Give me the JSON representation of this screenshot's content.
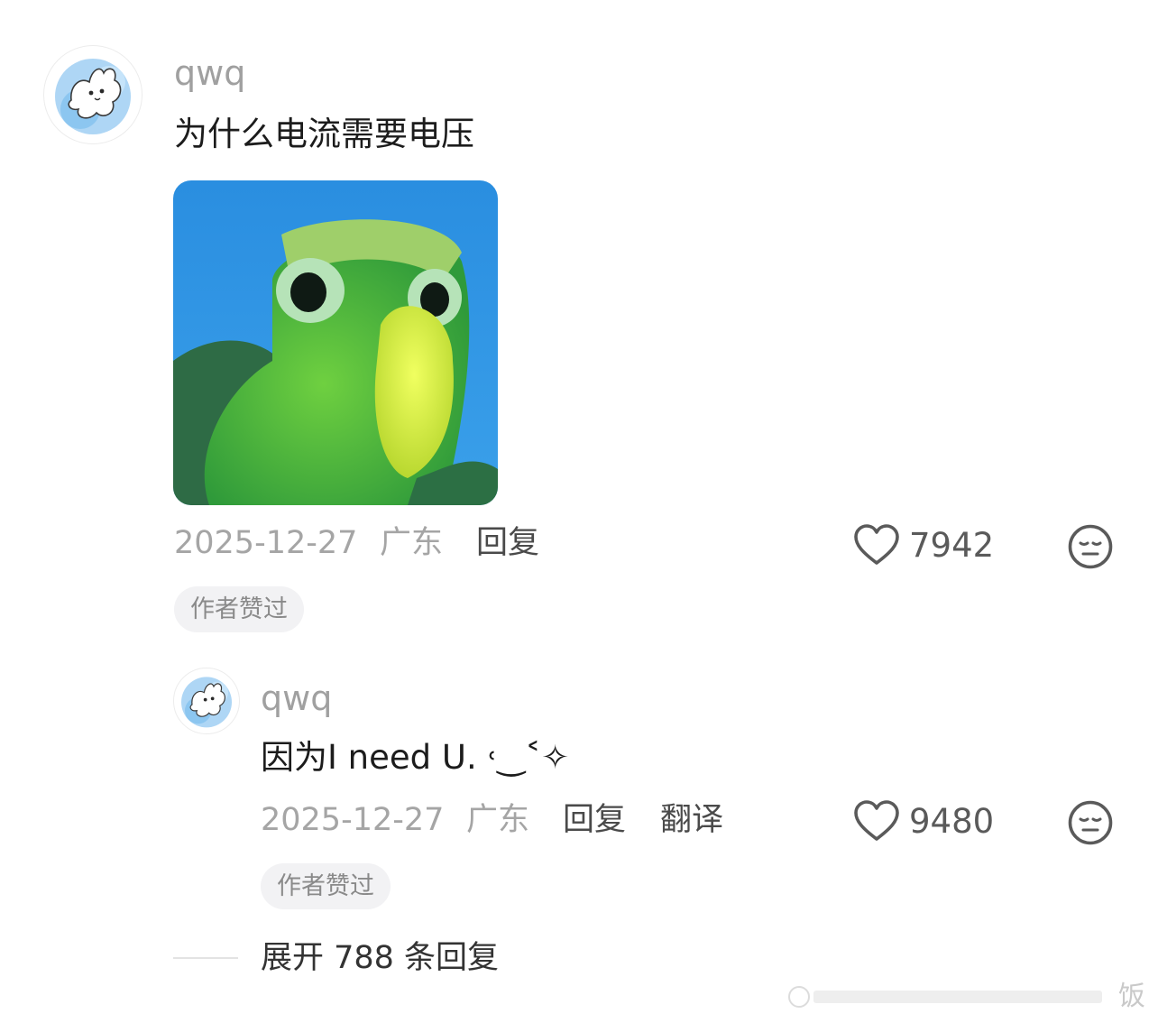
{
  "comment": {
    "username": "qwq",
    "text": "为什么电流需要电压",
    "date": "2025-12-27",
    "location": "广东",
    "reply_label": "回复",
    "likes": "7942",
    "badge": "作者赞过",
    "image_icon": "green-parrot-image",
    "avatar_icon": "white-bunny-avatar"
  },
  "reply": {
    "username": "qwq",
    "text": "因为I need U.  ˓‿˂✧",
    "date": "2025-12-27",
    "location": "广东",
    "reply_label": "回复",
    "translate_label": "翻译",
    "likes": "9480",
    "badge": "作者赞过",
    "avatar_icon": "white-bunny-avatar"
  },
  "expand": {
    "label": "展开 788 条回复"
  },
  "watermark": {
    "text": "饭"
  },
  "colors": {
    "accent_blue": "#3a96e3",
    "parrot_green": "#5cbc3a",
    "beak_yellow": "#d8ec3a"
  }
}
